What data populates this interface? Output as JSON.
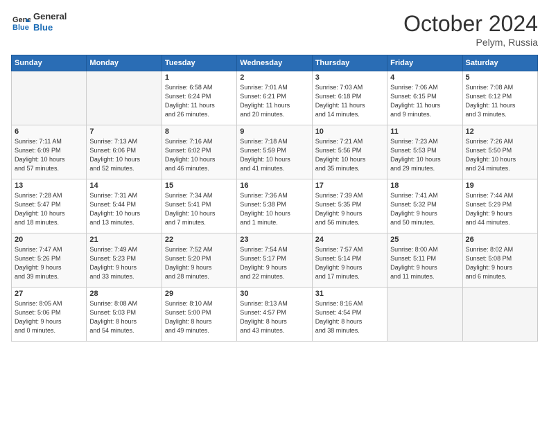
{
  "header": {
    "logo_general": "General",
    "logo_blue": "Blue",
    "month_title": "October 2024",
    "location": "Pelym, Russia"
  },
  "weekdays": [
    "Sunday",
    "Monday",
    "Tuesday",
    "Wednesday",
    "Thursday",
    "Friday",
    "Saturday"
  ],
  "weeks": [
    [
      {
        "day": "",
        "info": ""
      },
      {
        "day": "",
        "info": ""
      },
      {
        "day": "1",
        "info": "Sunrise: 6:58 AM\nSunset: 6:24 PM\nDaylight: 11 hours\nand 26 minutes."
      },
      {
        "day": "2",
        "info": "Sunrise: 7:01 AM\nSunset: 6:21 PM\nDaylight: 11 hours\nand 20 minutes."
      },
      {
        "day": "3",
        "info": "Sunrise: 7:03 AM\nSunset: 6:18 PM\nDaylight: 11 hours\nand 14 minutes."
      },
      {
        "day": "4",
        "info": "Sunrise: 7:06 AM\nSunset: 6:15 PM\nDaylight: 11 hours\nand 9 minutes."
      },
      {
        "day": "5",
        "info": "Sunrise: 7:08 AM\nSunset: 6:12 PM\nDaylight: 11 hours\nand 3 minutes."
      }
    ],
    [
      {
        "day": "6",
        "info": "Sunrise: 7:11 AM\nSunset: 6:09 PM\nDaylight: 10 hours\nand 57 minutes."
      },
      {
        "day": "7",
        "info": "Sunrise: 7:13 AM\nSunset: 6:06 PM\nDaylight: 10 hours\nand 52 minutes."
      },
      {
        "day": "8",
        "info": "Sunrise: 7:16 AM\nSunset: 6:02 PM\nDaylight: 10 hours\nand 46 minutes."
      },
      {
        "day": "9",
        "info": "Sunrise: 7:18 AM\nSunset: 5:59 PM\nDaylight: 10 hours\nand 41 minutes."
      },
      {
        "day": "10",
        "info": "Sunrise: 7:21 AM\nSunset: 5:56 PM\nDaylight: 10 hours\nand 35 minutes."
      },
      {
        "day": "11",
        "info": "Sunrise: 7:23 AM\nSunset: 5:53 PM\nDaylight: 10 hours\nand 29 minutes."
      },
      {
        "day": "12",
        "info": "Sunrise: 7:26 AM\nSunset: 5:50 PM\nDaylight: 10 hours\nand 24 minutes."
      }
    ],
    [
      {
        "day": "13",
        "info": "Sunrise: 7:28 AM\nSunset: 5:47 PM\nDaylight: 10 hours\nand 18 minutes."
      },
      {
        "day": "14",
        "info": "Sunrise: 7:31 AM\nSunset: 5:44 PM\nDaylight: 10 hours\nand 13 minutes."
      },
      {
        "day": "15",
        "info": "Sunrise: 7:34 AM\nSunset: 5:41 PM\nDaylight: 10 hours\nand 7 minutes."
      },
      {
        "day": "16",
        "info": "Sunrise: 7:36 AM\nSunset: 5:38 PM\nDaylight: 10 hours\nand 1 minute."
      },
      {
        "day": "17",
        "info": "Sunrise: 7:39 AM\nSunset: 5:35 PM\nDaylight: 9 hours\nand 56 minutes."
      },
      {
        "day": "18",
        "info": "Sunrise: 7:41 AM\nSunset: 5:32 PM\nDaylight: 9 hours\nand 50 minutes."
      },
      {
        "day": "19",
        "info": "Sunrise: 7:44 AM\nSunset: 5:29 PM\nDaylight: 9 hours\nand 44 minutes."
      }
    ],
    [
      {
        "day": "20",
        "info": "Sunrise: 7:47 AM\nSunset: 5:26 PM\nDaylight: 9 hours\nand 39 minutes."
      },
      {
        "day": "21",
        "info": "Sunrise: 7:49 AM\nSunset: 5:23 PM\nDaylight: 9 hours\nand 33 minutes."
      },
      {
        "day": "22",
        "info": "Sunrise: 7:52 AM\nSunset: 5:20 PM\nDaylight: 9 hours\nand 28 minutes."
      },
      {
        "day": "23",
        "info": "Sunrise: 7:54 AM\nSunset: 5:17 PM\nDaylight: 9 hours\nand 22 minutes."
      },
      {
        "day": "24",
        "info": "Sunrise: 7:57 AM\nSunset: 5:14 PM\nDaylight: 9 hours\nand 17 minutes."
      },
      {
        "day": "25",
        "info": "Sunrise: 8:00 AM\nSunset: 5:11 PM\nDaylight: 9 hours\nand 11 minutes."
      },
      {
        "day": "26",
        "info": "Sunrise: 8:02 AM\nSunset: 5:08 PM\nDaylight: 9 hours\nand 6 minutes."
      }
    ],
    [
      {
        "day": "27",
        "info": "Sunrise: 8:05 AM\nSunset: 5:06 PM\nDaylight: 9 hours\nand 0 minutes."
      },
      {
        "day": "28",
        "info": "Sunrise: 8:08 AM\nSunset: 5:03 PM\nDaylight: 8 hours\nand 54 minutes."
      },
      {
        "day": "29",
        "info": "Sunrise: 8:10 AM\nSunset: 5:00 PM\nDaylight: 8 hours\nand 49 minutes."
      },
      {
        "day": "30",
        "info": "Sunrise: 8:13 AM\nSunset: 4:57 PM\nDaylight: 8 hours\nand 43 minutes."
      },
      {
        "day": "31",
        "info": "Sunrise: 8:16 AM\nSunset: 4:54 PM\nDaylight: 8 hours\nand 38 minutes."
      },
      {
        "day": "",
        "info": ""
      },
      {
        "day": "",
        "info": ""
      }
    ]
  ]
}
